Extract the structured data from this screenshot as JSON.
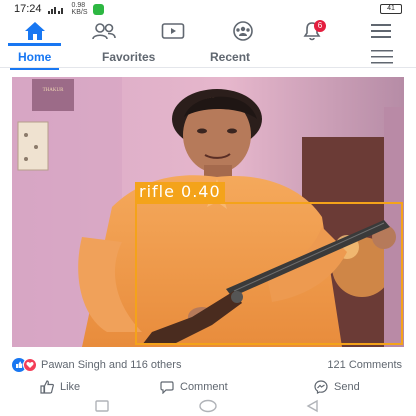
{
  "status_bar": {
    "time": "17:24",
    "net_speed": "0.98",
    "net_unit": "KB/S",
    "battery": "41"
  },
  "nav": {
    "notification_count": "6",
    "icons": [
      "home-icon",
      "friends-icon",
      "watch-icon",
      "groups-icon",
      "notifications-icon",
      "menu-icon"
    ]
  },
  "sub_tabs": {
    "home": "Home",
    "favorites": "Favorites",
    "recent": "Recent"
  },
  "post": {
    "photo_watermark": "THAKUR",
    "detection_label": "rifle 0.40",
    "reactions_text": "Pawan Singh and 116 others",
    "comments_text": "121 Comments",
    "like_label": "Like",
    "comment_label": "Comment",
    "send_label": "Send"
  },
  "colors": {
    "brand": "#1877f2",
    "detection_box": "#f4a31a",
    "badge": "#e41e3f"
  }
}
